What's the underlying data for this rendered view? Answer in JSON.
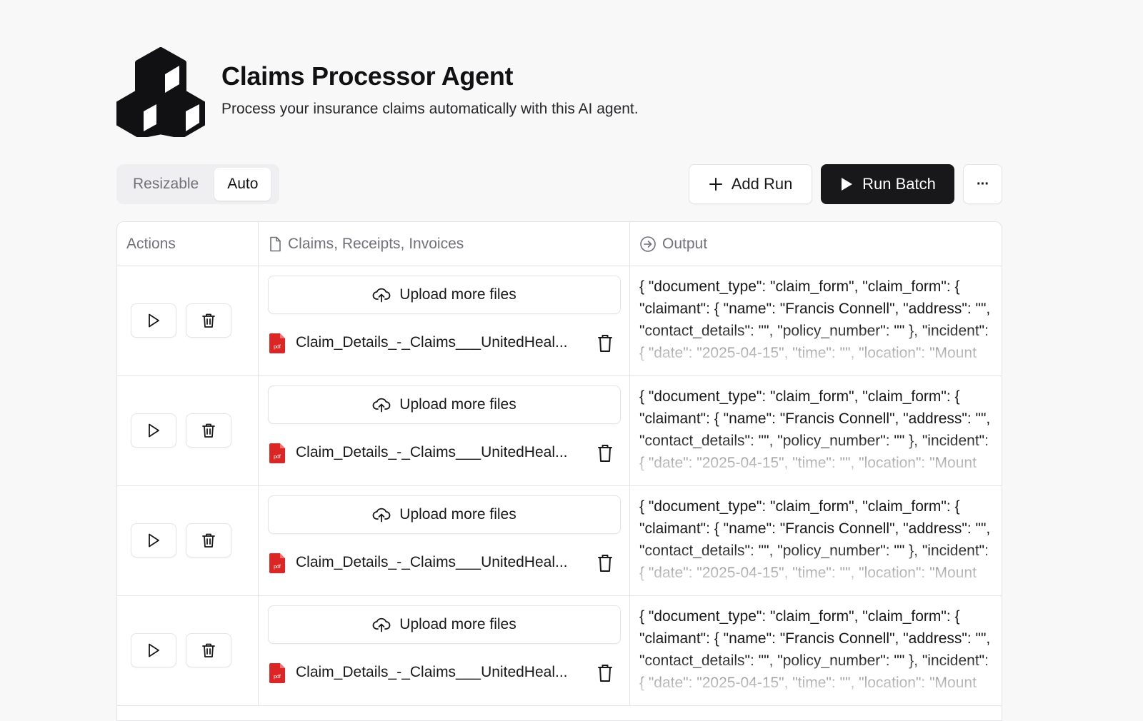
{
  "header": {
    "title": "Claims Processor Agent",
    "subtitle": "Process your insurance claims automatically with this AI agent.",
    "logo_icon": "cubes-logo-icon"
  },
  "toolbar": {
    "view_modes": [
      {
        "label": "Resizable",
        "active": false
      },
      {
        "label": "Auto",
        "active": true
      }
    ],
    "add_run_label": "Add Run",
    "run_batch_label": "Run Batch",
    "more_label": "···"
  },
  "table": {
    "columns": [
      {
        "label": "Actions",
        "icon": ""
      },
      {
        "label": "Claims, Receipts, Invoices",
        "icon": "file-icon"
      },
      {
        "label": "Output",
        "icon": "arrow-right-circle-icon"
      }
    ],
    "rows": [
      {
        "upload_label": "Upload more files",
        "file_name": "Claim_Details_-_Claims___UnitedHeal...",
        "output": "{ \"document_type\": \"claim_form\", \"claim_form\": { \"claimant\": { \"name\": \"Francis Connell\", \"address\": \"\", \"contact_details\": \"\", \"policy_number\": \"\" }, \"incident\": { \"date\": \"2025-04-15\", \"time\": \"\", \"location\": \"Mount"
      },
      {
        "upload_label": "Upload more files",
        "file_name": "Claim_Details_-_Claims___UnitedHeal...",
        "output": "{ \"document_type\": \"claim_form\", \"claim_form\": { \"claimant\": { \"name\": \"Francis Connell\", \"address\": \"\", \"contact_details\": \"\", \"policy_number\": \"\" }, \"incident\": { \"date\": \"2025-04-15\", \"time\": \"\", \"location\": \"Mount"
      },
      {
        "upload_label": "Upload more files",
        "file_name": "Claim_Details_-_Claims___UnitedHeal...",
        "output": "{ \"document_type\": \"claim_form\", \"claim_form\": { \"claimant\": { \"name\": \"Francis Connell\", \"address\": \"\", \"contact_details\": \"\", \"policy_number\": \"\" }, \"incident\": { \"date\": \"2025-04-15\", \"time\": \"\", \"location\": \"Mount"
      },
      {
        "upload_label": "Upload more files",
        "file_name": "Claim_Details_-_Claims___UnitedHeal...",
        "output": "{ \"document_type\": \"claim_form\", \"claim_form\": { \"claimant\": { \"name\": \"Francis Connell\", \"address\": \"\", \"contact_details\": \"\", \"policy_number\": \"\" }, \"incident\": { \"date\": \"2025-04-15\", \"time\": \"\", \"location\": \"Mount"
      }
    ]
  },
  "colors": {
    "background": "#f8f8f9",
    "primary_dark": "#18181b",
    "border": "#e4e4e7",
    "muted_text": "#71717a",
    "pdf_red": "#dc2626"
  }
}
